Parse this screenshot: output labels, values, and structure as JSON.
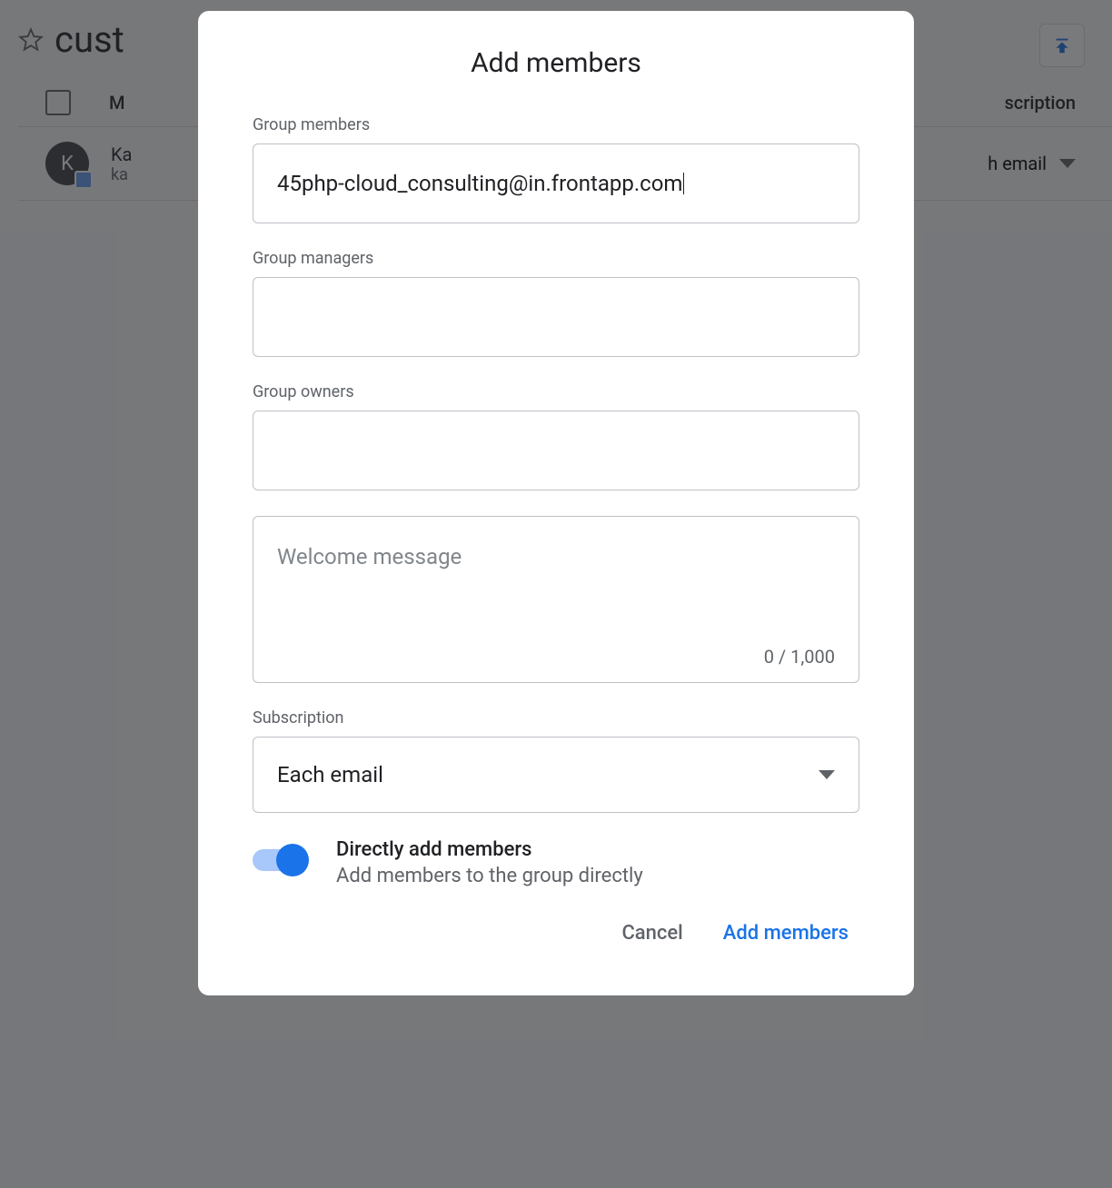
{
  "background": {
    "title": "cust",
    "columns": {
      "left": "M",
      "right": "scription"
    },
    "row": {
      "avatar_letter": "K",
      "name": "Ka",
      "email": "ka",
      "subscription": "h email"
    }
  },
  "modal": {
    "title": "Add members",
    "fields": {
      "members": {
        "label": "Group members",
        "value": "45php-cloud_consulting@in.frontapp.com"
      },
      "managers": {
        "label": "Group managers",
        "value": ""
      },
      "owners": {
        "label": "Group owners",
        "value": ""
      },
      "welcome": {
        "placeholder": "Welcome message",
        "counter": "0 / 1,000"
      },
      "subscription": {
        "label": "Subscription",
        "value": "Each email"
      }
    },
    "toggle": {
      "title": "Directly add members",
      "subtitle": "Add members to the group directly"
    },
    "actions": {
      "cancel": "Cancel",
      "submit": "Add members"
    }
  }
}
